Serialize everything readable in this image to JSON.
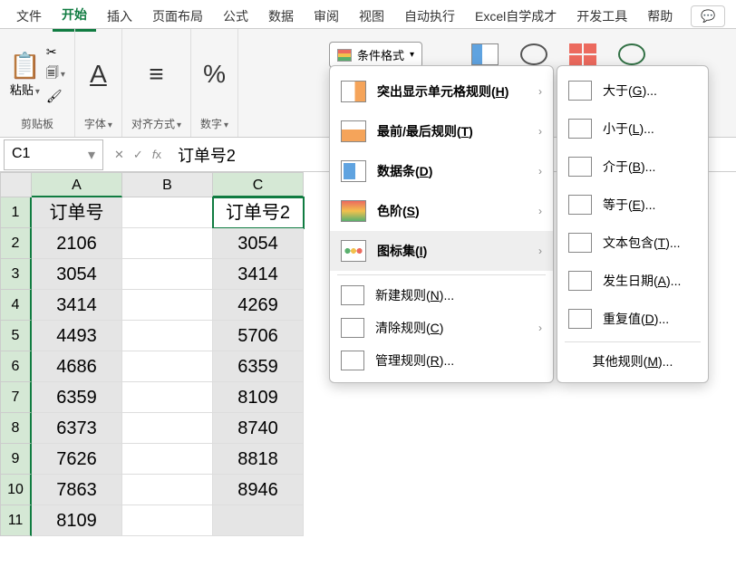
{
  "tabs": [
    "文件",
    "开始",
    "插入",
    "页面布局",
    "公式",
    "数据",
    "审阅",
    "视图",
    "自动执行",
    "Excel自学成才",
    "开发工具",
    "帮助"
  ],
  "active_tab": 1,
  "ribbon": {
    "clipboard": "剪贴板",
    "paste": "粘贴",
    "font": "字体",
    "align": "对齐方式",
    "number": "数字",
    "cf_button": "条件格式"
  },
  "namebox": "C1",
  "formula": "订单号2",
  "columns": [
    "A",
    "B",
    "C"
  ],
  "data": {
    "A": [
      "订单号",
      "2106",
      "3054",
      "3414",
      "4493",
      "4686",
      "6359",
      "6373",
      "7626",
      "7863",
      "8109"
    ],
    "B": [
      "",
      "",
      "",
      "",
      "",
      "",
      "",
      "",
      "",
      "",
      ""
    ],
    "C": [
      "订单号2",
      "3054",
      "3414",
      "4269",
      "5706",
      "6359",
      "8109",
      "8740",
      "8818",
      "8946",
      ""
    ]
  },
  "menu1": [
    {
      "label": "突出显示单元格规则(",
      "key": "H",
      "suffix": ")",
      "icon": "ic-highlight",
      "arrow": true
    },
    {
      "label": "最前/最后规则(",
      "key": "T",
      "suffix": ")",
      "icon": "ic-top",
      "arrow": true
    },
    {
      "label": "数据条(",
      "key": "D",
      "suffix": ")",
      "icon": "ic-databar",
      "arrow": true
    },
    {
      "label": "色阶(",
      "key": "S",
      "suffix": ")",
      "icon": "ic-colorscale",
      "arrow": true
    },
    {
      "label": "图标集(",
      "key": "I",
      "suffix": ")",
      "icon": "ic-iconset",
      "arrow": true,
      "hover": true
    }
  ],
  "menu1b": [
    {
      "label": "新建规则(",
      "key": "N",
      "suffix": ")..."
    },
    {
      "label": "清除规则(",
      "key": "C",
      "suffix": ")",
      "arrow": true
    },
    {
      "label": "管理规则(",
      "key": "R",
      "suffix": ")..."
    }
  ],
  "menu2": [
    {
      "label": "大于(",
      "key": "G",
      "suffix": ")..."
    },
    {
      "label": "小于(",
      "key": "L",
      "suffix": ")..."
    },
    {
      "label": "介于(",
      "key": "B",
      "suffix": ")..."
    },
    {
      "label": "等于(",
      "key": "E",
      "suffix": ")..."
    },
    {
      "label": "文本包含(",
      "key": "T",
      "suffix": ")..."
    },
    {
      "label": "发生日期(",
      "key": "A",
      "suffix": ")..."
    },
    {
      "label": "重复值(",
      "key": "D",
      "suffix": ")..."
    }
  ],
  "menu2_more": {
    "label": "其他规则(",
    "key": "M",
    "suffix": ")..."
  }
}
